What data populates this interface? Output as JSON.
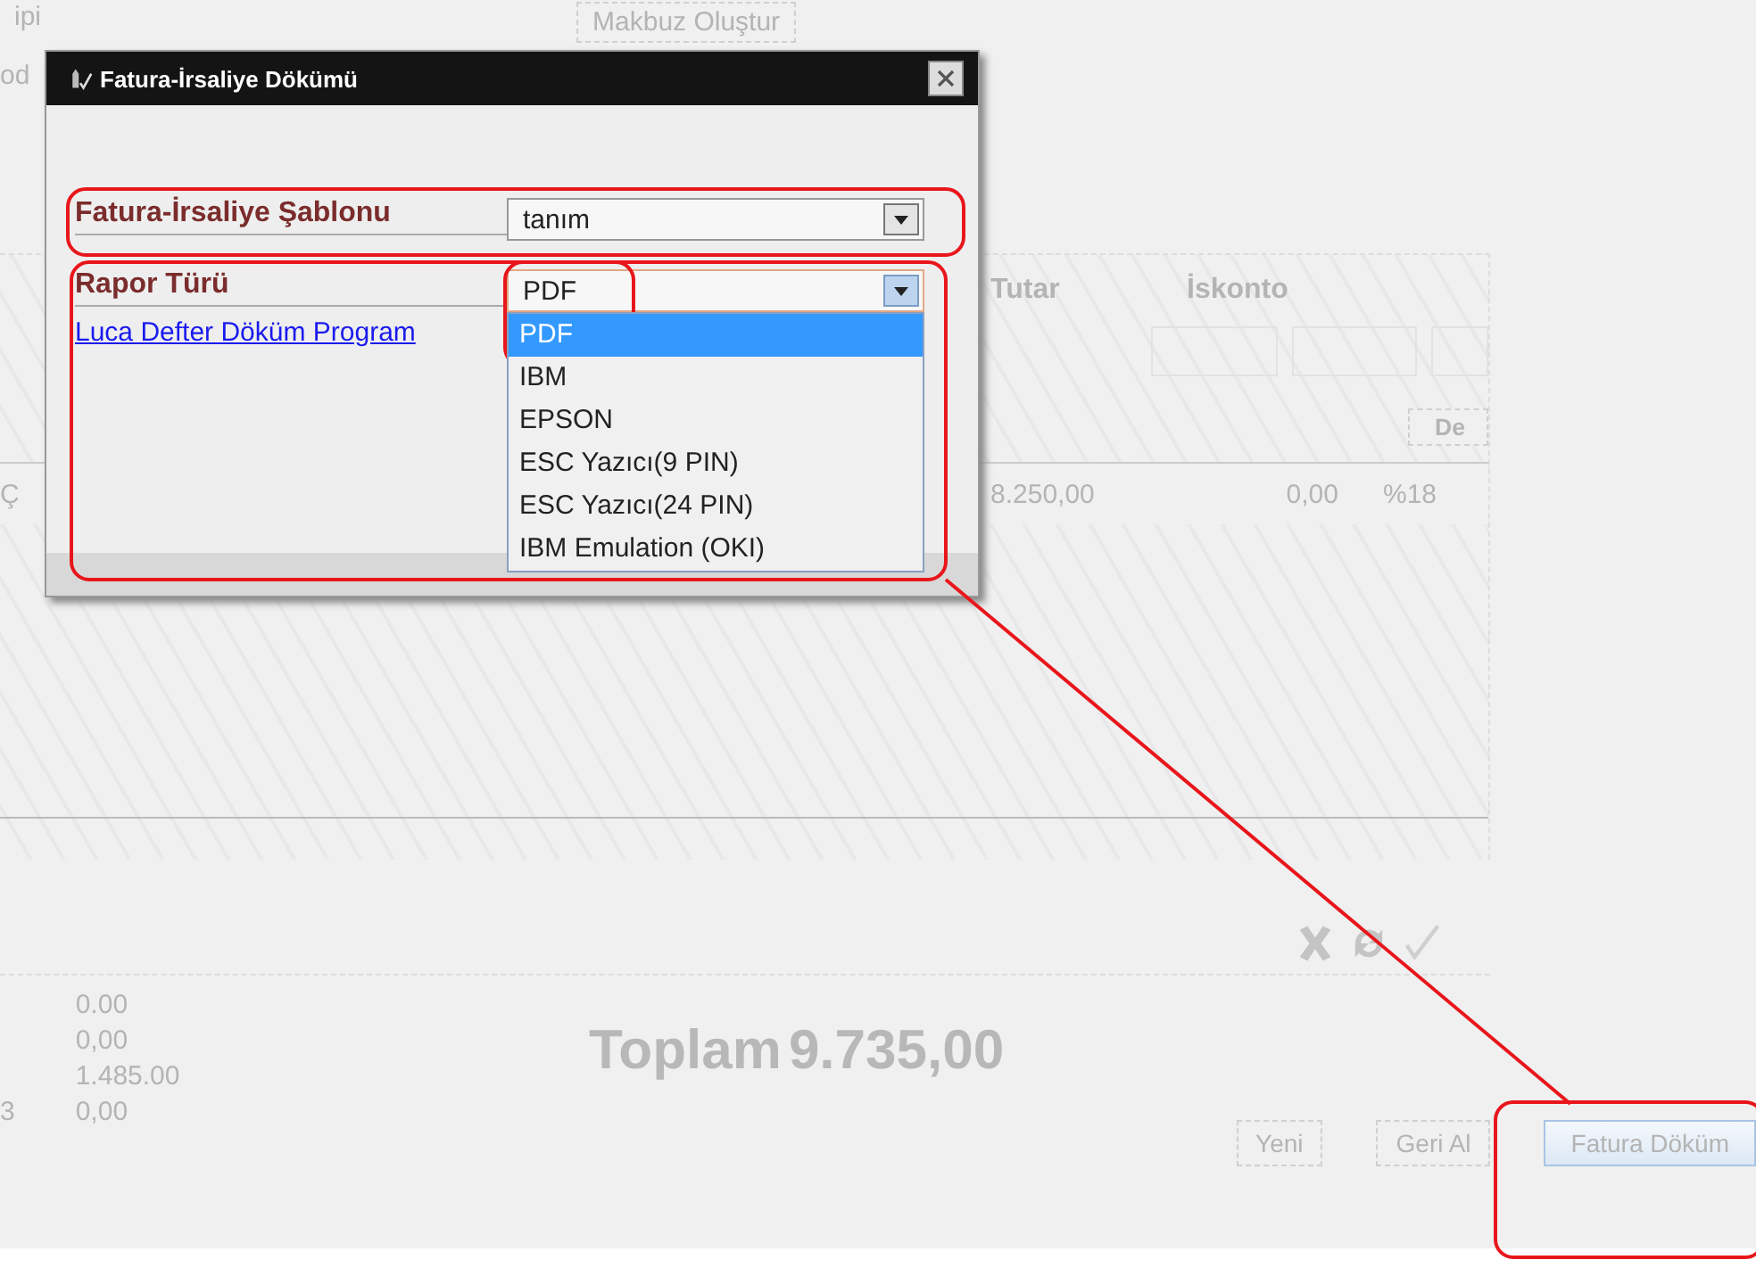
{
  "background_form": {
    "top_label": "ipi",
    "receipt_button": "Makbuz Oluştur",
    "side_label": "od",
    "table": {
      "columns": [
        "Tutar",
        "İskonto"
      ],
      "filter_button": "De",
      "rows": [
        {
          "column_1": "Ç",
          "amount": "8.250,00",
          "discount": "0,00",
          "tax": "%18"
        }
      ]
    },
    "totals": {
      "row_label": "3",
      "values": [
        "0.00",
        "0,00",
        "1.485.00",
        "0,00"
      ],
      "total_label": "Toplam",
      "total_value": "9.735,00"
    },
    "buttons": [
      {
        "label": "Yeni",
        "selected": false
      },
      {
        "label": "Geri Al",
        "selected": false
      },
      {
        "label": "Fatura Döküm",
        "selected": true
      }
    ]
  },
  "dialog": {
    "title": "Fatura-İrsaliye Dökümü",
    "fields": [
      {
        "label": "Fatura-İrsaliye Şablonu",
        "value": "tanım",
        "expanded": false
      },
      {
        "label": "Rapor Türü",
        "value": "PDF",
        "expanded": true,
        "options": [
          {
            "label": "PDF",
            "selected": true
          },
          {
            "label": "IBM",
            "selected": false
          },
          {
            "label": "EPSON",
            "selected": false
          },
          {
            "label": "ESC Yazıcı(9 PIN)",
            "selected": false
          },
          {
            "label": "ESC Yazıcı(24 PIN)",
            "selected": false
          },
          {
            "label": "IBM Emulation (OKI)",
            "selected": false
          }
        ]
      }
    ],
    "link": "Luca Defter Döküm Program"
  }
}
